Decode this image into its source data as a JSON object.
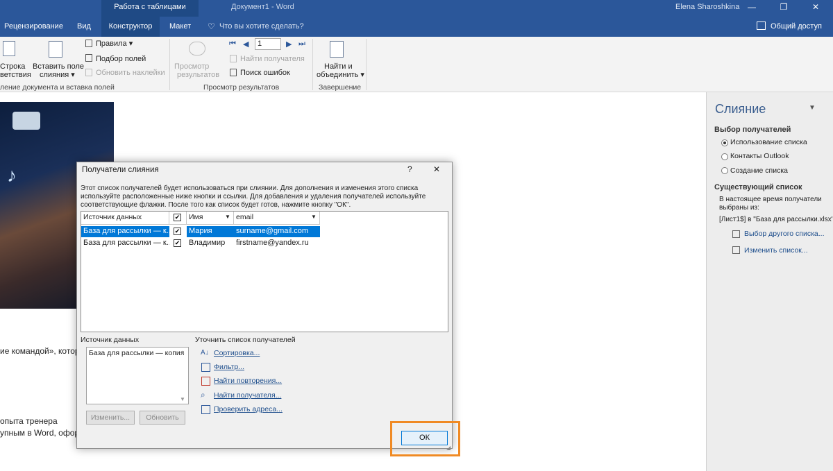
{
  "titlebar": {
    "tools_tab": "Работа с таблицами",
    "doc_title": "Документ1  -  Word",
    "user": "Elena Sharoshkina",
    "min": "—",
    "restore": "❐",
    "close": "✕"
  },
  "tabs": [
    {
      "label": "Рецензирование"
    },
    {
      "label": "Вид"
    },
    {
      "label": "Конструктор"
    },
    {
      "label": "Макет"
    }
  ],
  "tell_me": "Что вы хотите сделать?",
  "share": "Общий доступ",
  "ribbon": {
    "stroka_1": "Строка",
    "stroka_2": "ветствия",
    "insert_field_1": "Вставить поле",
    "insert_field_2": "слияния ▾",
    "rules": "Правила ▾",
    "match_fields": "Подбор полей",
    "update_labels": "Обновить наклейки",
    "preview_1": "Просмотр",
    "preview_2": "результатов",
    "record_value": "1",
    "find_recipient": "Найти получателя",
    "check_errors": "Поиск ошибок",
    "finish_1": "Найти и",
    "finish_2": "объединить ▾",
    "group1": "ление документа и вставка полей",
    "group2": "Просмотр результатов",
    "group3": "Завершение"
  },
  "document": {
    "line1": "ие командой», котор",
    "line2": "опыта тренера",
    "line3": "упным в Word, офор"
  },
  "pane": {
    "title": "Слияние",
    "select_heading": "Выбор получателей",
    "options": [
      "Использование списка",
      "Контакты Outlook",
      "Создание списка"
    ],
    "existing_heading": "Существующий список",
    "existing_text_1": "В настоящее время получатели",
    "existing_text_2": "выбраны из:",
    "source": "[Лист1$] в \"База для рассылки.xlsx\"",
    "choose_other": "Выбор другого списка...",
    "edit_list": "Изменить список..."
  },
  "dialog": {
    "title": "Получатели слияния",
    "help": "?",
    "close": "✕",
    "description": "Этот список получателей будет использоваться при слиянии. Для дополнения и изменения этого списка используйте расположенные ниже кнопки и ссылки. Для добавления и удаления получателей используйте соответствующие флажки. После того как список будет готов, нажмите кнопку \"ОК\".",
    "columns": {
      "source": "Источник данных",
      "check": "✔",
      "name": "Имя",
      "email": "email"
    },
    "rows": [
      {
        "source": "База для рассылки — к...",
        "check": "✔",
        "name": "Мария",
        "email": "surname@gmail.com"
      },
      {
        "source": "База для рассылки — к...",
        "check": "✔",
        "name": "Владимир",
        "email": "firstname@yandex.ru"
      }
    ],
    "ds_label": "Источник данных",
    "ds_item": "База для рассылки — копия",
    "edit_btn": "Изменить...",
    "refresh_btn": "Обновить",
    "refine_label": "Уточнить список получателей",
    "links": [
      "Сортировка...",
      "Фильтр...",
      "Найти повторения...",
      "Найти получателя...",
      "Проверить адреса..."
    ],
    "ok": "ОК"
  },
  "colors": {
    "ribbon_blue": "#2b579a",
    "highlight": "#f08a24",
    "selection": "#0078d7"
  }
}
